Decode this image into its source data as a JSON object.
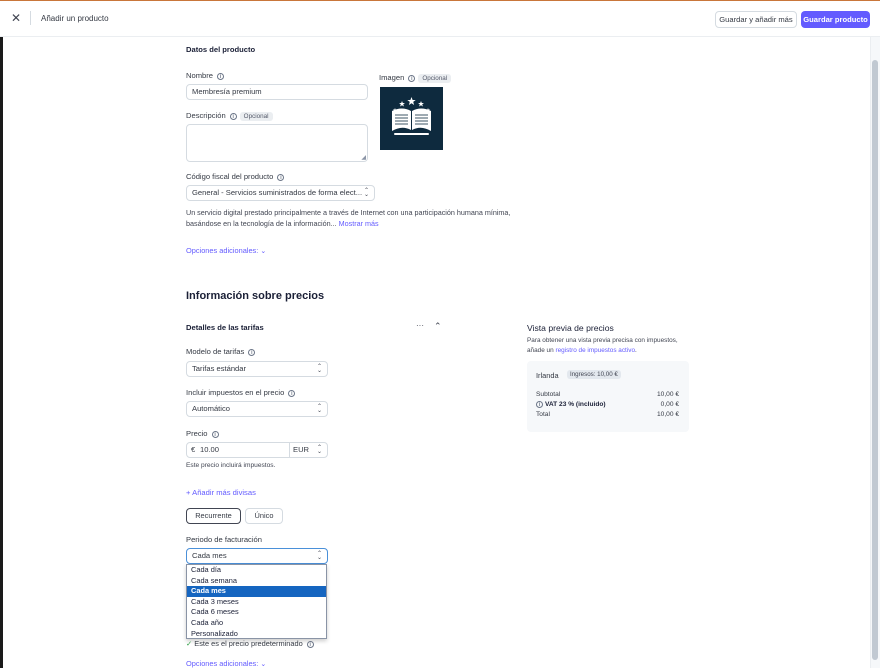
{
  "header": {
    "close_icon": "close-icon",
    "title": "Añadir un producto",
    "save_add_more": "Guardar y añadir más",
    "save_product": "Guardar producto"
  },
  "product": {
    "section_title": "Datos del producto",
    "name_label": "Nombre",
    "name_value": "Membresía premium",
    "image_label": "Imagen",
    "optional": "Opcional",
    "description_label": "Descripción",
    "description_value": "",
    "tax_code_label": "Código fiscal del producto",
    "tax_code_value": "General - Servicios suministrados de forma elect...",
    "tax_desc_line1": "Un servicio digital prestado principalmente a través de Internet con una participación humana mínima,",
    "tax_desc_line2": "basándose en la tecnología de la información...",
    "show_more": "Mostrar más",
    "more_options": "Opciones adicionales:"
  },
  "pricing": {
    "section_title": "Información sobre precios",
    "rate_details": "Detalles de las tarifas",
    "more_icon": "···",
    "pricing_model_label": "Modelo de tarifas",
    "pricing_model_value": "Tarifas estándar",
    "include_tax_label": "Incluir impuestos en el precio",
    "include_tax_value": "Automático",
    "price_label": "Precio",
    "currency_symbol": "€",
    "price_value": "10.00",
    "currency": "EUR",
    "price_note": "Este precio incluirá impuestos.",
    "add_currencies": "Añadir más divisas",
    "recurring": "Recurrente",
    "one_time": "Único",
    "billing_period_label": "Periodo de facturación",
    "billing_period_value": "Cada mes",
    "billing_options": [
      "Cada día",
      "Cada semana",
      "Cada mes",
      "Cada 3 meses",
      "Cada 6 meses",
      "Cada año",
      "Personalizado"
    ],
    "selected_option_index": 2,
    "default_price": "Este es el precio predeterminado",
    "more_options": "Opciones adicionales:"
  },
  "preview": {
    "title": "Vista previa de precios",
    "desc_line1": "Para obtener una vista previa precisa con impuestos,",
    "desc_line2_prefix": "añade un",
    "desc_line2_link": "registro de impuestos activo",
    "desc_line2_suffix": ".",
    "country": "Irlanda",
    "revenue_badge": "Ingresos: 10,00 €",
    "subtotal_label": "Subtotal",
    "subtotal_value": "10,00 €",
    "vat_label": "VAT 23 % (incluido)",
    "vat_value": "0,00 €",
    "total_label": "Total",
    "total_value": "10,00 €"
  },
  "colors": {
    "accent": "#635bff",
    "dropdown_selected": "#1565c0",
    "check": "#2e9e44"
  }
}
